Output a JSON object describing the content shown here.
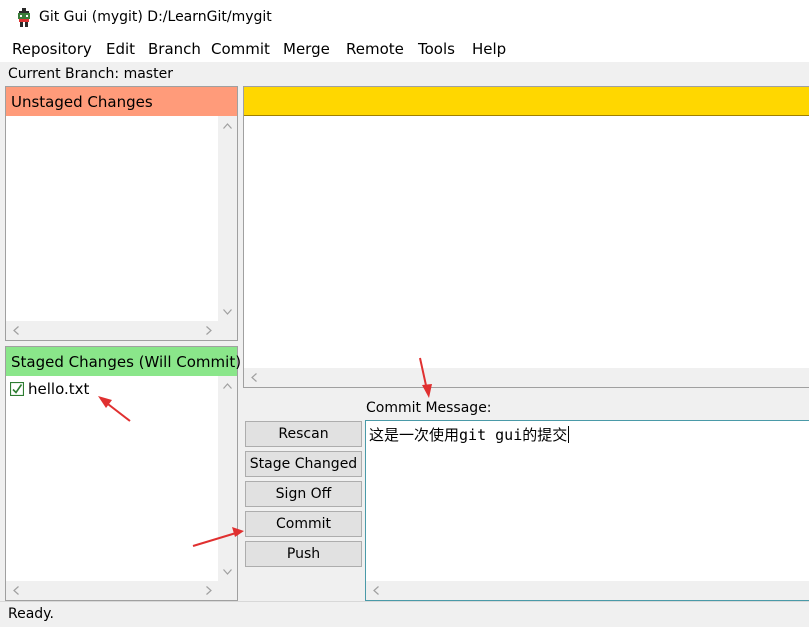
{
  "window": {
    "title": "Git Gui (mygit) D:/LearnGit/mygit"
  },
  "menu": [
    "Repository",
    "Edit",
    "Branch",
    "Commit",
    "Merge",
    "Remote",
    "Tools",
    "Help"
  ],
  "branch": {
    "label": "Current Branch: master"
  },
  "unstaged": {
    "header": "Unstaged Changes",
    "header_color": "#ff9b7a"
  },
  "staged": {
    "header": "Staged Changes (Will Commit)",
    "header_color": "#8ae68a",
    "files": [
      {
        "name": "hello.txt",
        "icon": "checkbox-checked-icon"
      }
    ]
  },
  "diff": {
    "header_color": "#ffd700"
  },
  "buttons": {
    "rescan": "Rescan",
    "stage_changed": "Stage Changed",
    "sign_off": "Sign Off",
    "commit": "Commit",
    "push": "Push"
  },
  "commit_message": {
    "label": "Commit Message:",
    "text_pre": "这是一次使用",
    "text_code": "git gui",
    "text_post": "的提交"
  },
  "status": {
    "text": "Ready."
  }
}
